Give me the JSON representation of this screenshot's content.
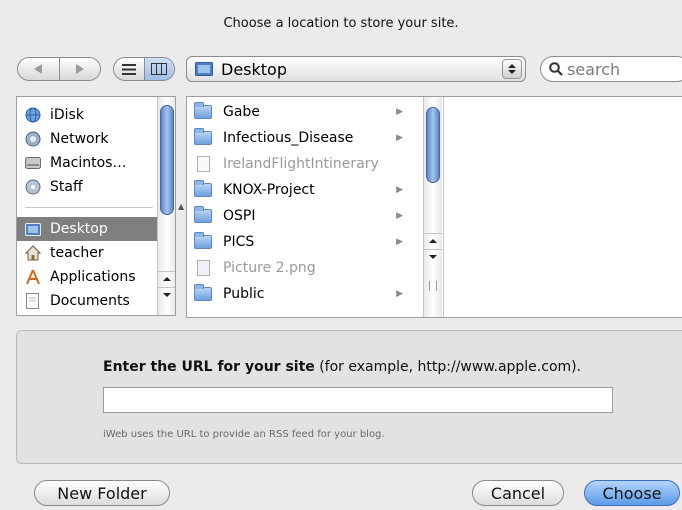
{
  "dialog": {
    "prompt": "Choose a location to store your site."
  },
  "toolbar": {
    "location": "Desktop",
    "search_placeholder": "search"
  },
  "sidebar": {
    "devices": [
      {
        "label": "iDisk",
        "icon": "globe-icon"
      },
      {
        "label": "Network",
        "icon": "network-icon"
      },
      {
        "label": "Macintos…",
        "icon": "harddrive-icon"
      },
      {
        "label": "Staff",
        "icon": "disk-icon"
      }
    ],
    "places": [
      {
        "label": "Desktop",
        "icon": "desktop-icon",
        "selected": true
      },
      {
        "label": "teacher",
        "icon": "home-icon"
      },
      {
        "label": "Applications",
        "icon": "applications-icon"
      },
      {
        "label": "Documents",
        "icon": "documents-icon"
      }
    ]
  },
  "browser": {
    "items": [
      {
        "label": "Gabe",
        "kind": "folder"
      },
      {
        "label": "Infectious_Disease",
        "kind": "folder"
      },
      {
        "label": "IrelandFlightIntinerary",
        "kind": "document",
        "disabled": true
      },
      {
        "label": "KNOX-Project",
        "kind": "folder"
      },
      {
        "label": "OSPI",
        "kind": "folder"
      },
      {
        "label": "PICS",
        "kind": "folder"
      },
      {
        "label": "Picture 2.png",
        "kind": "image",
        "disabled": true
      },
      {
        "label": "Public",
        "kind": "folder"
      }
    ]
  },
  "url_section": {
    "label_bold": "Enter the URL for your site",
    "label_rest": " (for example, http://www.apple.com).",
    "value": "",
    "hint": "iWeb uses the URL to provide an RSS feed for your blog."
  },
  "buttons": {
    "new_folder": "New Folder",
    "cancel": "Cancel",
    "choose": "Choose"
  },
  "colors": {
    "accent": "#5b9be9",
    "selection": "#7f7f7f"
  }
}
